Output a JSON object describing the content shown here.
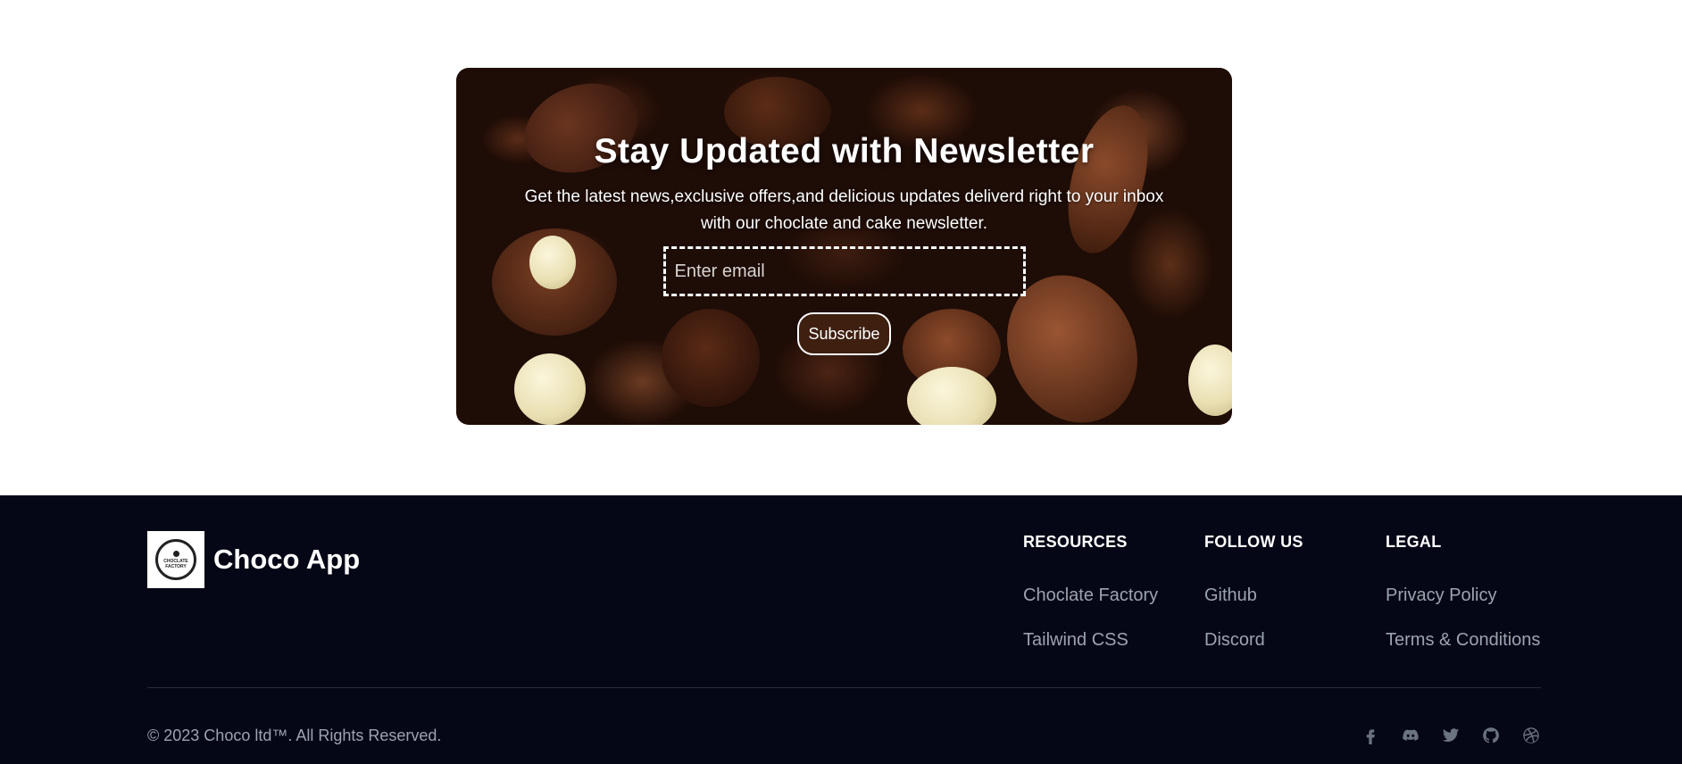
{
  "newsletter": {
    "title": "Stay Updated with Newsletter",
    "description": "Get the latest news,exclusive offers,and delicious updates deliverd right to your inbox with our choclate and cake newsletter.",
    "email_placeholder": "Enter email",
    "subscribe_label": "Subscribe"
  },
  "footer": {
    "brand": {
      "logo_text_line1": "CHOCLATE",
      "logo_text_line2": "FACTORY",
      "name": "Choco App"
    },
    "columns": [
      {
        "heading": "RESOURCES",
        "links": [
          "Choclate Factory",
          "Tailwind CSS"
        ]
      },
      {
        "heading": "FOLLOW US",
        "links": [
          "Github",
          "Discord"
        ]
      },
      {
        "heading": "LEGAL",
        "links": [
          "Privacy Policy",
          "Terms & Conditions"
        ]
      }
    ],
    "copyright": "© 2023 Choco ltd™. All Rights Reserved.",
    "social_icons": [
      "facebook-icon",
      "discord-icon",
      "twitter-icon",
      "github-icon",
      "dribbble-icon"
    ]
  },
  "colors": {
    "footer_bg": "#050716",
    "button_bg": "#3e1f10",
    "muted_text": "#9ca3af"
  }
}
